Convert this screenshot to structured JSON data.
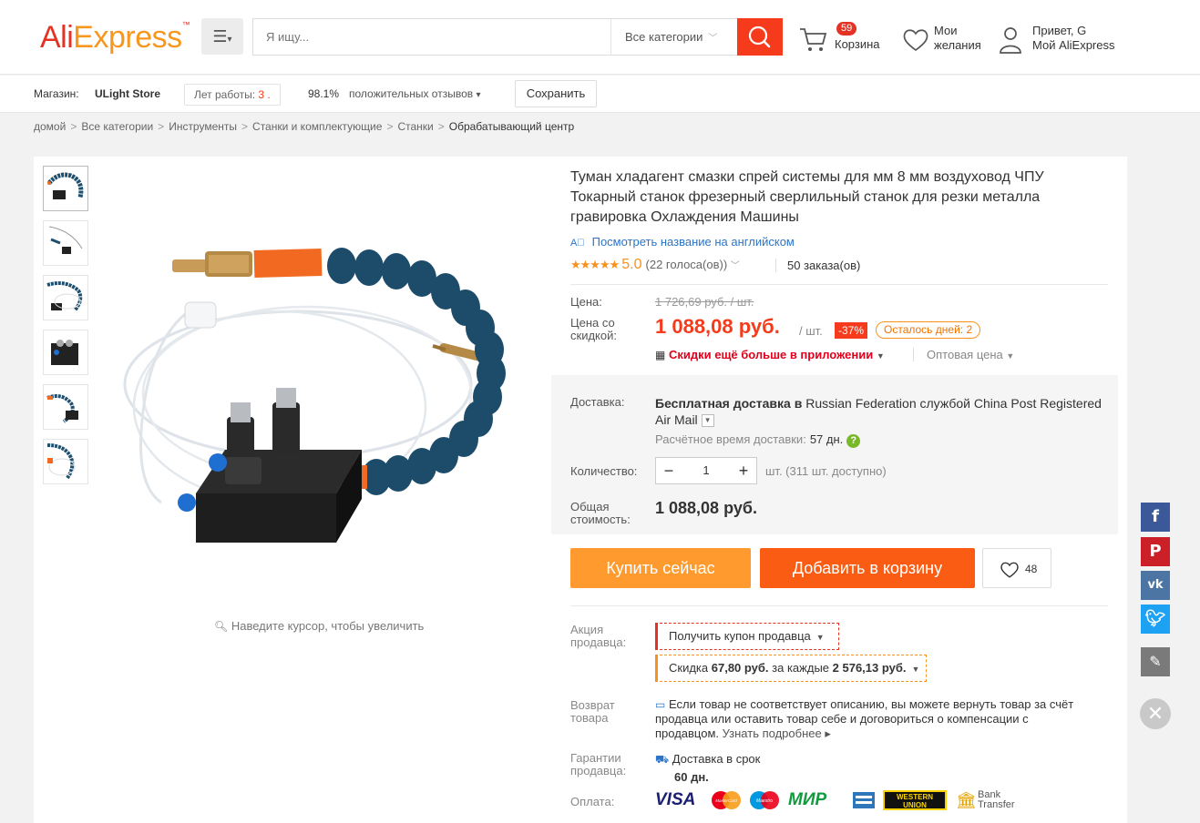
{
  "header": {
    "logo": {
      "part1": "Ali",
      "part2": "Express"
    },
    "search": {
      "placeholder": "Я ищу...",
      "category": "Все категории"
    },
    "cart": {
      "count": "59",
      "label": "Корзина"
    },
    "wishlist": {
      "line1": "Мои",
      "line2": "желания"
    },
    "account": {
      "line1": "Привет, G",
      "line2": "Мой AliExpress"
    }
  },
  "store": {
    "label": "Магазин:",
    "name": "ULight Store",
    "years_label": "Лет работы:",
    "years_value": "3 .",
    "positive_pct": "98.1%",
    "positive_label": "положительных отзывов",
    "save_label": "Сохранить"
  },
  "breadcrumb": [
    "домой",
    "Все категории",
    "Инструменты",
    "Станки и комплектующие",
    "Станки",
    "Обрабатывающий центр"
  ],
  "product": {
    "title": "Туман хладагент смазки спрей системы для мм 8 мм воздуховод ЧПУ Токарный станок фрезерный сверлильный станок для резки металла гравировка Охлаждения Машины",
    "translate_label": "Посмотреть название на английском",
    "rating_value": "5.0",
    "votes": "(22 голоса(ов))",
    "orders": "50 заказа(ов)",
    "zoom_hint": "Наведите курсор, чтобы увеличить"
  },
  "pricing": {
    "price_label": "Цена:",
    "old_price": "1 726,69 руб. / шт.",
    "discount_label_1": "Цена со",
    "discount_label_2": "скидкой:",
    "price": "1 088,08 руб.",
    "per_unit": "/ шт.",
    "discount_pct": "-37%",
    "days_left": "Осталось дней: 2",
    "app_discount": "Скидки ещё больше в приложении",
    "wholesale": "Оптовая цена"
  },
  "shipping": {
    "label": "Доставка:",
    "text_bold": "Бесплатная доставка в",
    "text_rest": "Russian Federation службой China Post Registered Air Mail",
    "time_label": "Расчётное время доставки:",
    "time_value": "57 дн."
  },
  "quantity": {
    "label": "Количество:",
    "value": "1",
    "available": "шт. (311 шт. доступно)"
  },
  "total": {
    "label_1": "Общая",
    "label_2": "стоимость:",
    "value": "1 088,08 руб."
  },
  "actions": {
    "buy_now": "Купить сейчас",
    "add_to_cart": "Добавить в корзину",
    "wish_count": "48"
  },
  "seller_promo": {
    "label_1": "Акция",
    "label_2": "продавца:",
    "coupon": "Получить купон продавца",
    "discount_prefix": "Скидка ",
    "discount_amount": "67,80 руб.",
    "discount_mid": " за каждые ",
    "discount_threshold": "2 576,13 руб."
  },
  "returns": {
    "label_1": "Возврат",
    "label_2": "товара",
    "text": "Если товар не соответствует описанию, вы можете вернуть товар за счёт продавца или оставить товар себе и договориться о компенсации с продавцом.",
    "more": "Узнать подробнее"
  },
  "guarantee": {
    "label_1": "Гарантии",
    "label_2": "продавца:",
    "line1": "Доставка в срок",
    "line2": "60 дн."
  },
  "payment": {
    "label": "Оплата:",
    "visa": "VISA",
    "mastercard": "MasterCard",
    "maestro": "Maestro",
    "mir": "МИР",
    "wu_1": "WESTERN",
    "wu_2": "UNION",
    "bank_1": "Bank",
    "bank_2": "Transfer"
  },
  "social": {
    "colors": {
      "facebook": "#3b5998",
      "pinterest": "#cb2027",
      "vk": "#4c75a3",
      "twitter": "#1da1f2",
      "edit": "#7a7a7a"
    }
  }
}
